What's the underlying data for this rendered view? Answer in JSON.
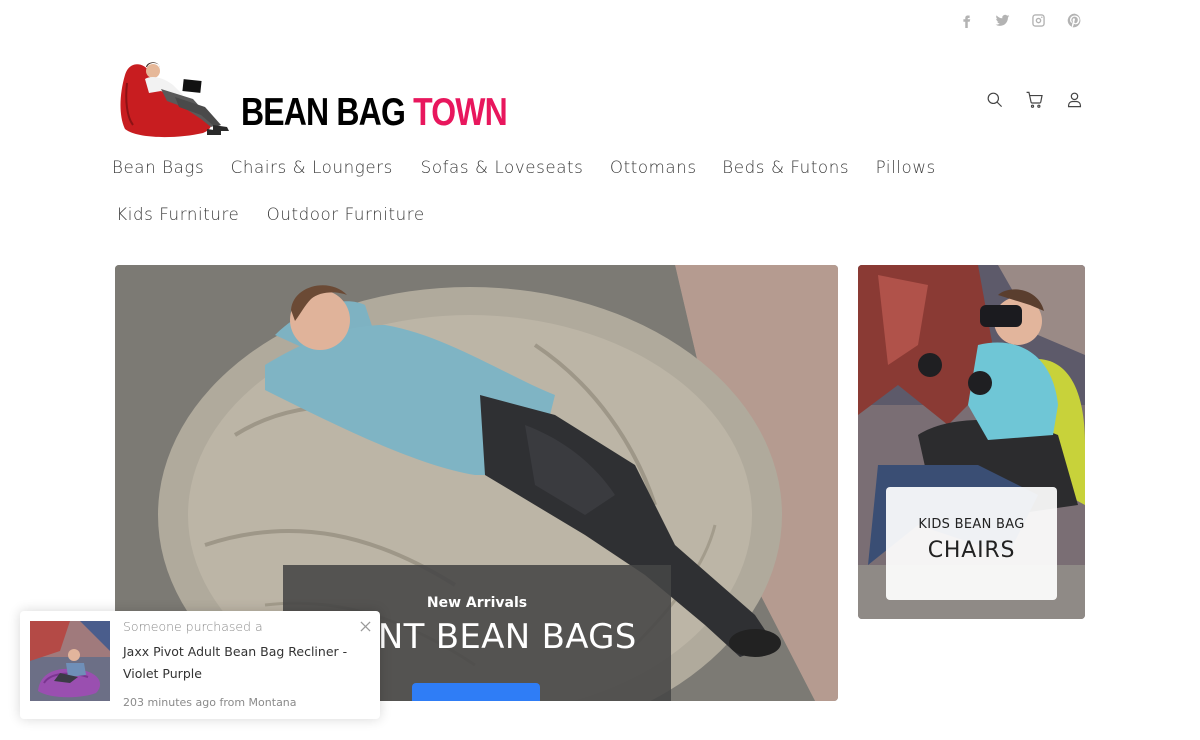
{
  "social": [
    {
      "name": "facebook-icon"
    },
    {
      "name": "twitter-icon"
    },
    {
      "name": "instagram-icon"
    },
    {
      "name": "pinterest-icon"
    }
  ],
  "logo": {
    "word1": "BEAN BAG",
    "word2": "TOWN",
    "accent_color": "#e8175d"
  },
  "header_icons": [
    "search-icon",
    "cart-icon",
    "user-icon"
  ],
  "nav": {
    "row1": [
      "Bean Bags",
      "Chairs & Loungers",
      "Sofas & Loveseats",
      "Ottomans",
      "Beds & Futons",
      "Pillows"
    ],
    "row2": [
      "Kids Furniture",
      "Outdoor Furniture"
    ]
  },
  "hero": {
    "subtitle": "New Arrivals",
    "title": "GIANT BEAN BAGS",
    "button_color": "#2f7df6"
  },
  "promo": {
    "line1": "KIDS BEAN BAG",
    "line2": "CHAIRS"
  },
  "notification": {
    "intro": "Someone purchased a",
    "product": "Jaxx Pivot Adult Bean Bag Recliner - Violet Purple",
    "time": "203 minutes ago from Montana"
  }
}
